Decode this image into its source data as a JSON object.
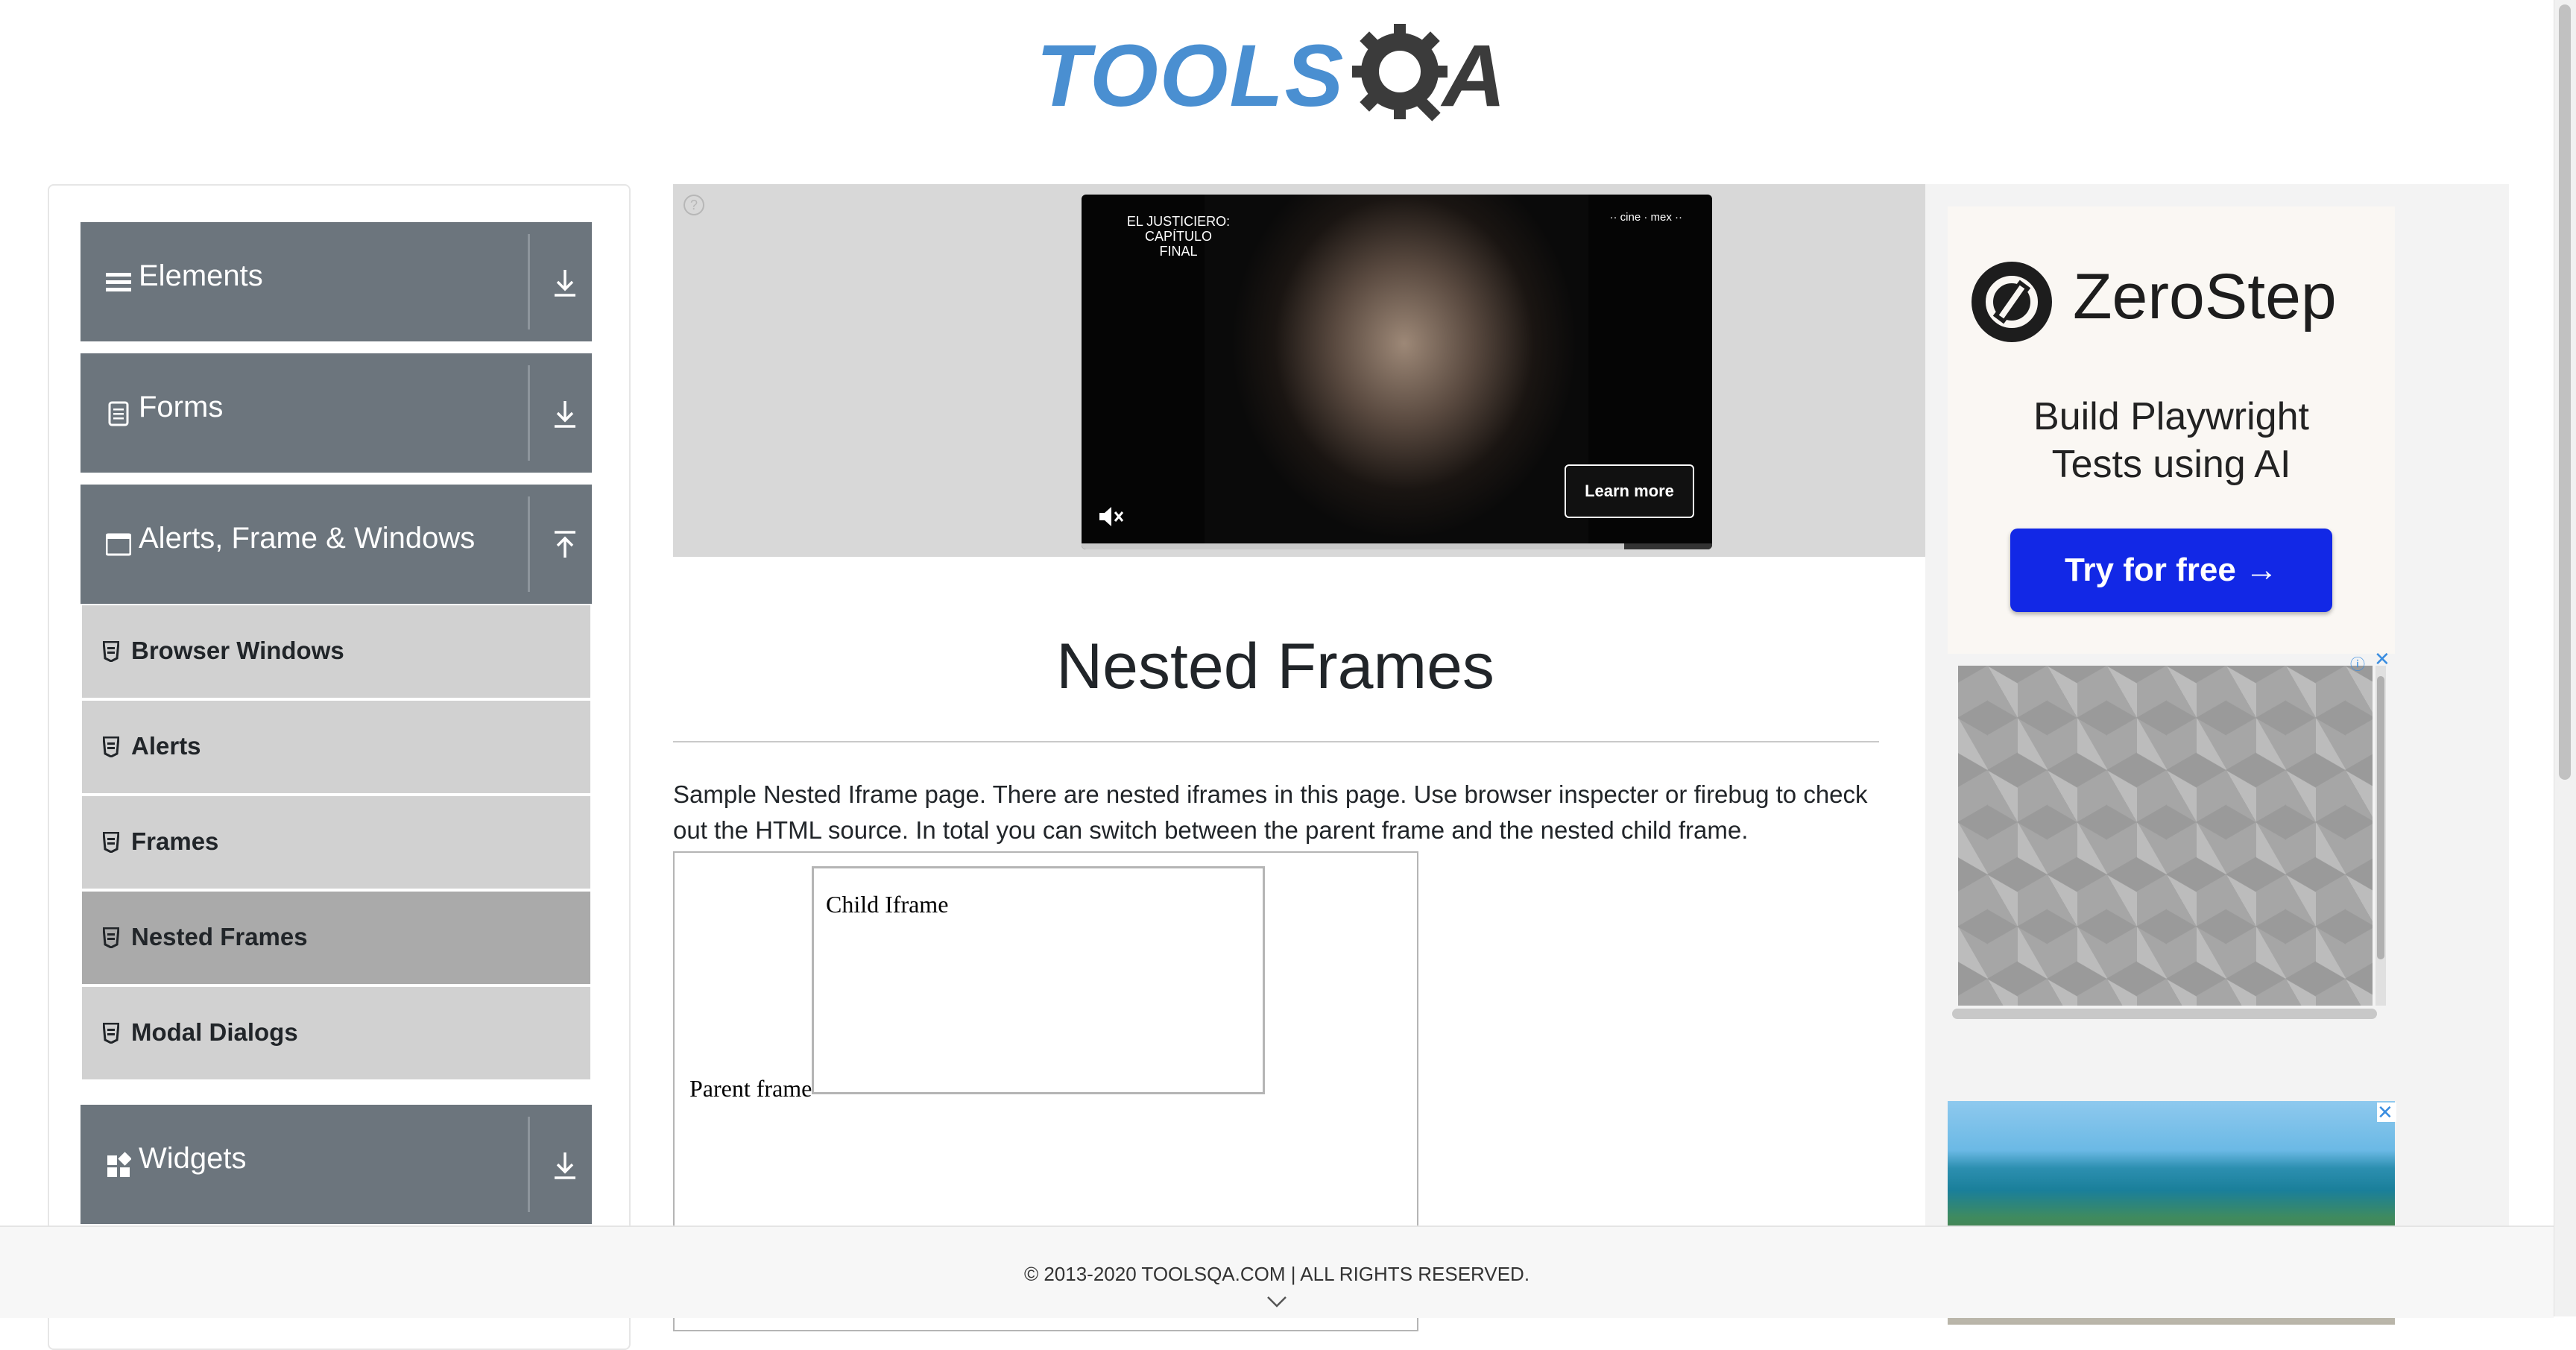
{
  "logo": {
    "tools_text": "TOOLS",
    "a_text": "A",
    "colors": {
      "blue": "#4a8fd1",
      "dark": "#3b3b3b"
    }
  },
  "sidebar": {
    "groups": [
      {
        "label": "Elements",
        "icon": "list-icon",
        "arrow": "download-arrow-icon"
      },
      {
        "label": "Forms",
        "icon": "document-icon",
        "arrow": "download-arrow-icon"
      },
      {
        "label": "Alerts, Frame & Windows",
        "icon": "window-icon",
        "arrow": "upload-arrow-icon"
      },
      {
        "label": "Widgets",
        "icon": "widgets-icon",
        "arrow": "download-arrow-icon"
      }
    ],
    "items": [
      {
        "label": "Browser Windows",
        "active": false
      },
      {
        "label": "Alerts",
        "active": false
      },
      {
        "label": "Frames",
        "active": false
      },
      {
        "label": "Nested Frames",
        "active": true
      },
      {
        "label": "Modal Dialogs",
        "active": false
      }
    ]
  },
  "top_ad": {
    "video_title": "EL JUSTICIERO:\nCAPÍTULO FINAL",
    "brand": "·· cine · mex ··",
    "learn_more": "Learn more",
    "progress": 0.86
  },
  "main": {
    "title": "Nested Frames",
    "description": "Sample Nested Iframe page. There are nested iframes in this page. Use browser inspecter or firebug to check out the HTML source. In total you can switch between the parent frame and the nested child frame.",
    "parent_frame_label": "Parent frame",
    "child_frame_label": "Child Iframe"
  },
  "right_ad": {
    "brand": "ZeroStep",
    "tagline": "Build Playwright Tests using AI",
    "button": "Try for free →",
    "button_color": "#1228e6"
  },
  "footer": {
    "text": "© 2013-2020 TOOLSQA.COM | ALL RIGHTS RESERVED."
  }
}
